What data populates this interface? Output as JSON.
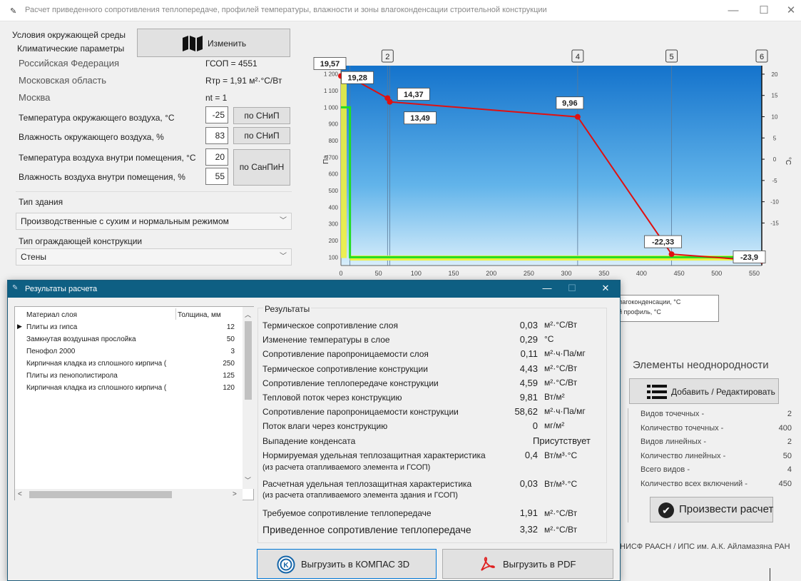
{
  "window": {
    "title": "Расчет приведенного сопротивления теплопередаче, профилей температуры, влажности и зоны влагоконденсации строительной конструкции",
    "minimize": "—",
    "maximize": "☐",
    "close": "✕"
  },
  "env": {
    "section_title": "Условия окружающей среды",
    "climate_label": "Климатические параметры",
    "change_button": "Изменить",
    "country": "Российская Федерация",
    "region": "Московская область",
    "city": "Москва",
    "gsop": "ГСОП = 4551",
    "rtr": "Rтр = 1,91 м²·°С/Вт",
    "nt": "nt = 1",
    "outdoor_temp_label": "Температура окружающего воздуха, °С",
    "outdoor_temp_value": "-25",
    "outdoor_temp_btn": "по СНиП",
    "outdoor_hum_label": "Влажность окружающего воздуха, %",
    "outdoor_hum_value": "83",
    "outdoor_hum_btn": "по СНиП",
    "indoor_temp_label": "Температура воздуха внутри помещения, °С",
    "indoor_temp_value": "20",
    "indoor_hum_label": "Влажность воздуха внутри помещения, %",
    "indoor_hum_value": "55",
    "indoor_btn": "по СанПиН"
  },
  "building": {
    "type_label": "Тип здания",
    "type_value": "Производственные с сухим и нормальным режимом",
    "enclosure_label": "Тип ограждающей конструкции",
    "enclosure_value": "Стены"
  },
  "chart_data": {
    "type": "line",
    "xlabel": "",
    "ylabel": "Па",
    "y2label": "°С",
    "x_ticks": [
      "0",
      "50",
      "100",
      "150",
      "200",
      "250",
      "300",
      "350",
      "400",
      "450",
      "500",
      "550"
    ],
    "y_ticks": [
      "100",
      "200",
      "300",
      "400",
      "500",
      "600",
      "700",
      "800",
      "900",
      "1 000",
      "1 100",
      "1 200"
    ],
    "y2_ticks": [
      "20",
      "15",
      "10",
      "5",
      "0",
      "-5",
      "-10",
      "-15"
    ],
    "xlim": [
      0,
      560
    ],
    "ylim": [
      50,
      1250
    ],
    "y2lim": [
      -25,
      22
    ],
    "layer_markers": [
      "2",
      "4",
      "5",
      "6"
    ],
    "layer_boundaries_mm": [
      0,
      12,
      62,
      65,
      315,
      440,
      560
    ],
    "temperature_series": {
      "name": "",
      "color": "#e01010",
      "x": [
        0,
        12,
        62,
        65,
        315,
        440,
        560
      ],
      "y": [
        19.57,
        19.28,
        14.37,
        13.49,
        9.96,
        -22.33,
        -23.9
      ]
    },
    "temperature_labels": [
      "19,57",
      "19,28",
      "14,37",
      "13,49",
      "9,96",
      "-22,33",
      "-23,9"
    ],
    "green_series": {
      "color": "#22dd22",
      "x": [
        0,
        12,
        12,
        560
      ],
      "y": [
        1000,
        1000,
        100,
        100
      ]
    },
    "yellow_series": {
      "color": "#f0f040",
      "x": [
        0,
        560
      ],
      "y": [
        1200,
        95
      ]
    }
  },
  "legend_partial": {
    "line1": "лагоконденсации, °С",
    "line2": "й профиль, °С"
  },
  "inhomogeneity": {
    "title": "Элементы неоднородности",
    "add_button": "Добавить / Редактировать",
    "stats": [
      {
        "label": "Видов точечных -",
        "value": "2"
      },
      {
        "label": "Количество точечных -",
        "value": "400"
      },
      {
        "label": "Видов линейных -",
        "value": "2"
      },
      {
        "label": "Количество линейных -",
        "value": "50"
      },
      {
        "label": "Всего видов -",
        "value": "4"
      },
      {
        "label": "Количество всех включений -",
        "value": "450"
      }
    ],
    "calc_button": "Произвести расчет",
    "footer": "НИСФ РААСН / ИПС им. А.К. Айламазяна РАН"
  },
  "results": {
    "title": "Результаты расчета",
    "table_headers": [
      "Материал слоя",
      "Толщина, мм"
    ],
    "layers": [
      {
        "name": "Плиты из гипса",
        "thickness": "12"
      },
      {
        "name": "Замкнутая воздушная прослойка",
        "thickness": "50"
      },
      {
        "name": "Пенофол 2000",
        "thickness": "3"
      },
      {
        "name": "Кирпичная кладка из сплошного кирпича (",
        "thickness": "250"
      },
      {
        "name": "Плиты из пенополистирола",
        "thickness": "125"
      },
      {
        "name": "Кирпичная кладка из сплошного кирпича (",
        "thickness": "120"
      }
    ],
    "group_title": "Результаты",
    "rows": [
      {
        "label": "Термическое сопротивление слоя",
        "value": "0,03",
        "unit": "м²·°С/Вт"
      },
      {
        "label": "Изменение температуры в слое",
        "value": "0,29",
        "unit": "°С"
      },
      {
        "label": "Сопротивление паропроницаемости слоя",
        "value": "0,11",
        "unit": "м²·ч·Па/мг"
      },
      {
        "label": "Термическое сопротивление конструкции",
        "value": "4,43",
        "unit": "м²·°С/Вт"
      },
      {
        "label": "Сопротивление теплопередаче конструкции",
        "value": "4,59",
        "unit": "м²·°С/Вт"
      },
      {
        "label": "Тепловой поток через конструкцию",
        "value": "9,81",
        "unit": "Вт/м²"
      },
      {
        "label": "Сопротивление паропроницаемости конструкции",
        "value": "58,62",
        "unit": "м²·ч·Па/мг"
      },
      {
        "label": "Поток влаги через конструкцию",
        "value": "0",
        "unit": "мг/м²"
      },
      {
        "label": "Выпадение конденсата",
        "value": "",
        "unit": "Присутствует"
      }
    ],
    "norm_label_1": "Нормируемая удельная теплозащитная характеристика",
    "norm_label_2": "(из расчета отапливаемого элемента и ГСОП)",
    "norm_value": "0,4",
    "norm_unit": "Вт/м³·°С",
    "calc_label_1": "Расчетная удельная теплозащитная характеристика",
    "calc_label_2": "(из расчета отапливаемого элемента здания и ГСОП)",
    "calc_value": "0,03",
    "calc_unit": "Вт/м³·°С",
    "required_label": "Требуемое сопротивление теплопередаче",
    "required_value": "1,91",
    "required_unit": "м²·°С/Вт",
    "reduced_label": "Приведенное сопротивление теплопередаче",
    "reduced_value": "3,32",
    "reduced_unit": "м²·°С/Вт",
    "export_kompas": "Выгрузить в КОМПАС 3D",
    "export_pdf": "Выгрузить в PDF"
  }
}
